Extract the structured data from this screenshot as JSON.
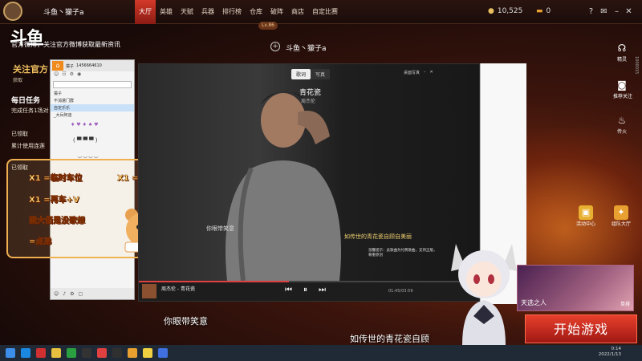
{
  "game_top": {
    "username": "斗鱼丶獴子a",
    "nav": [
      "大厅",
      "英雄",
      "天赋",
      "兵器",
      "排行榜",
      "仓库",
      "破阵",
      "商店",
      "自定比赛"
    ],
    "active_nav": "大厅",
    "currency1": "10,525",
    "currency2": "0",
    "level": "Lv.86",
    "stream_title": "斗鱼丶獴子a",
    "side_id": "1000015"
  },
  "overlay": {
    "douyu_logo": "斗鱼",
    "marquee": "官方微博，关注官方微博获取最新资讯"
  },
  "left_panel": {
    "follow_title": "关注官方",
    "follow_sub": "获取",
    "daily_title": "每日任务",
    "daily_text": "完成任务1场对",
    "claimed1": "已领取",
    "cumulative": "累计使用连莲",
    "claimed2": "已领取"
  },
  "chat": {
    "user": "獴子",
    "user_id": "1456664610",
    "rows": [
      "獴子",
      "不消遣门群",
      "自定乐乐",
      "_大兵阿迪"
    ]
  },
  "stickers": {
    "line1": "X1 =临时车位",
    "line1b": "X1 =当兵车位",
    "line2": "X1 =再车+V",
    "line3": "熊大佰是没歌想",
    "line4": "=点弟"
  },
  "player": {
    "tab_left": "歌词",
    "tab_right": "写真",
    "top_right": "桌面写真",
    "song": "青花瓷",
    "artist": "周杰伦",
    "lyric_left": "你眼带笑意",
    "lyric_right": "如传世的青花瓷自顾自美丽",
    "notice": "温馨提示：此歌曲为付费歌曲，支持正版，尊重原创",
    "bar_title": "周杰伦 - 青花瓷",
    "time": "01:45/03:59",
    "progress_pct": 44
  },
  "right_icons": [
    "精灵",
    "推荐关注",
    "传火"
  ],
  "mid_icons": [
    "活动中心",
    "组队大厅"
  ],
  "event": {
    "name": "天选之人",
    "tag": "单排"
  },
  "start_button": "开始游戏",
  "subtitles": {
    "line1": "你眼带笑意",
    "line2": "如传世的青花瓷自顾"
  },
  "taskbar": {
    "time": "0:14",
    "date": "2022/1/13"
  },
  "colors": {
    "accent": "#d43a28",
    "sticker": "#ffe27a",
    "progress": "#e04040"
  }
}
